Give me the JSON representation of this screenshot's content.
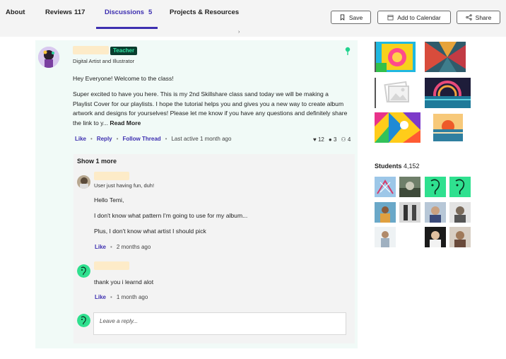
{
  "tabs": [
    {
      "label": "About",
      "count": ""
    },
    {
      "label": "Reviews",
      "count": "117"
    },
    {
      "label": "Discussions",
      "count": "5"
    },
    {
      "label": "Projects & Resources",
      "count": ""
    }
  ],
  "toolbar": {
    "save_label": "Save",
    "calendar_label": "Add to Calendar",
    "share_label": "Share"
  },
  "post": {
    "badge": "Teacher",
    "author_title": "Digital Artist and Illustrator",
    "greeting": "Hey Everyone! Welcome to the class!",
    "body": "Super excited to have you here. This is my 2nd Skillshare class sand today we will be making a Playlist Cover for our playlists. I hope the tutorial helps you and gives you a new way to create album artwork and designs for yourselves! Please let me know if you have any questions and definitely share the link to y...",
    "read_more": "Read More",
    "like": "Like",
    "reply": "Reply",
    "follow": "Follow Thread",
    "last_active": "Last active 1 month ago",
    "likes_count": "12",
    "comments_count": "3",
    "followers_count": "4"
  },
  "replies": {
    "show_more": "Show 1 more",
    "items": [
      {
        "tagline": "User just having fun, duh!",
        "lines": [
          "Hello Temi,",
          "I don't know what pattern I'm going to use for my album...",
          "Plus, I don't know what artist I should pick"
        ],
        "like": "Like",
        "time": "2 months ago"
      },
      {
        "lines": [
          "thank you i learnd alot"
        ],
        "like": "Like",
        "time": "1 month ago"
      }
    ],
    "input_placeholder": "Leave a reply..."
  },
  "students": {
    "label": "Students",
    "count": "4,152"
  },
  "colors": {
    "accent": "#3d2fb0",
    "panel_bg": "#f1faf7",
    "badge_bg": "#0a3d2e",
    "badge_text": "#2fe0a0",
    "name_placeholder": "#fdebc8"
  },
  "icons": [
    "bookmark-icon",
    "calendar-icon",
    "share-icon",
    "pin-icon",
    "heart-icon",
    "comment-icon",
    "followers-icon",
    "image-placeholder-icon"
  ]
}
